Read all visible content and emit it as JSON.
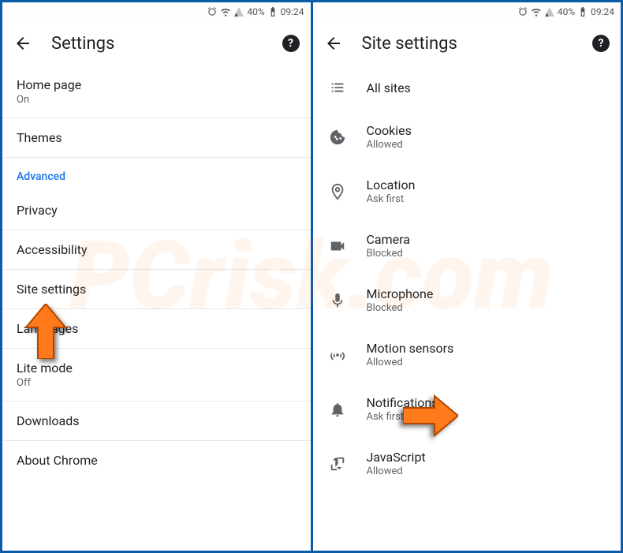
{
  "status": {
    "battery_pct": "40%",
    "time": "09:24"
  },
  "left": {
    "title": "Settings",
    "items": [
      {
        "label": "Home page",
        "sub": "On"
      },
      {
        "label": "Themes"
      }
    ],
    "section": "Advanced",
    "advanced_items": [
      {
        "label": "Privacy"
      },
      {
        "label": "Accessibility"
      },
      {
        "label": "Site settings"
      },
      {
        "label": "Languages"
      },
      {
        "label": "Lite mode",
        "sub": "Off"
      },
      {
        "label": "Downloads"
      },
      {
        "label": "About Chrome"
      }
    ]
  },
  "right": {
    "title": "Site settings",
    "items": [
      {
        "icon": "list-icon",
        "label": "All sites"
      },
      {
        "icon": "cookie-icon",
        "label": "Cookies",
        "sub": "Allowed"
      },
      {
        "icon": "location-icon",
        "label": "Location",
        "sub": "Ask first"
      },
      {
        "icon": "camera-icon",
        "label": "Camera",
        "sub": "Blocked"
      },
      {
        "icon": "microphone-icon",
        "label": "Microphone",
        "sub": "Blocked"
      },
      {
        "icon": "sensors-icon",
        "label": "Motion sensors",
        "sub": "Allowed"
      },
      {
        "icon": "notifications-icon",
        "label": "Notifications",
        "sub": "Ask first"
      },
      {
        "icon": "javascript-icon",
        "label": "JavaScript",
        "sub": "Allowed"
      }
    ]
  },
  "watermark": "PCrisk.com"
}
